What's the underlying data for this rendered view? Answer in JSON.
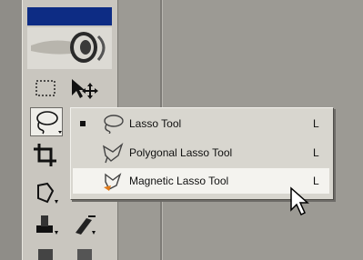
{
  "flyout": {
    "items": [
      {
        "label": "Lasso Tool",
        "shortcut": "L",
        "icon": "lasso-icon",
        "selected": true
      },
      {
        "label": "Polygonal Lasso Tool",
        "shortcut": "L",
        "icon": "polygonal-lasso-icon",
        "selected": false
      },
      {
        "label": "Magnetic Lasso Tool",
        "shortcut": "L",
        "icon": "magnetic-lasso-icon",
        "selected": false,
        "hovered": true
      }
    ]
  },
  "toolbox": {
    "tools": [
      "marquee-icon",
      "move-icon",
      "lasso-icon",
      "crop-icon",
      "patch-icon",
      "stamp-icon",
      "history-brush-icon"
    ]
  },
  "colors": {
    "titlebar": "#0d2c84",
    "menu_bg": "#d8d6cf",
    "menu_hover": "#f4f3ef"
  }
}
